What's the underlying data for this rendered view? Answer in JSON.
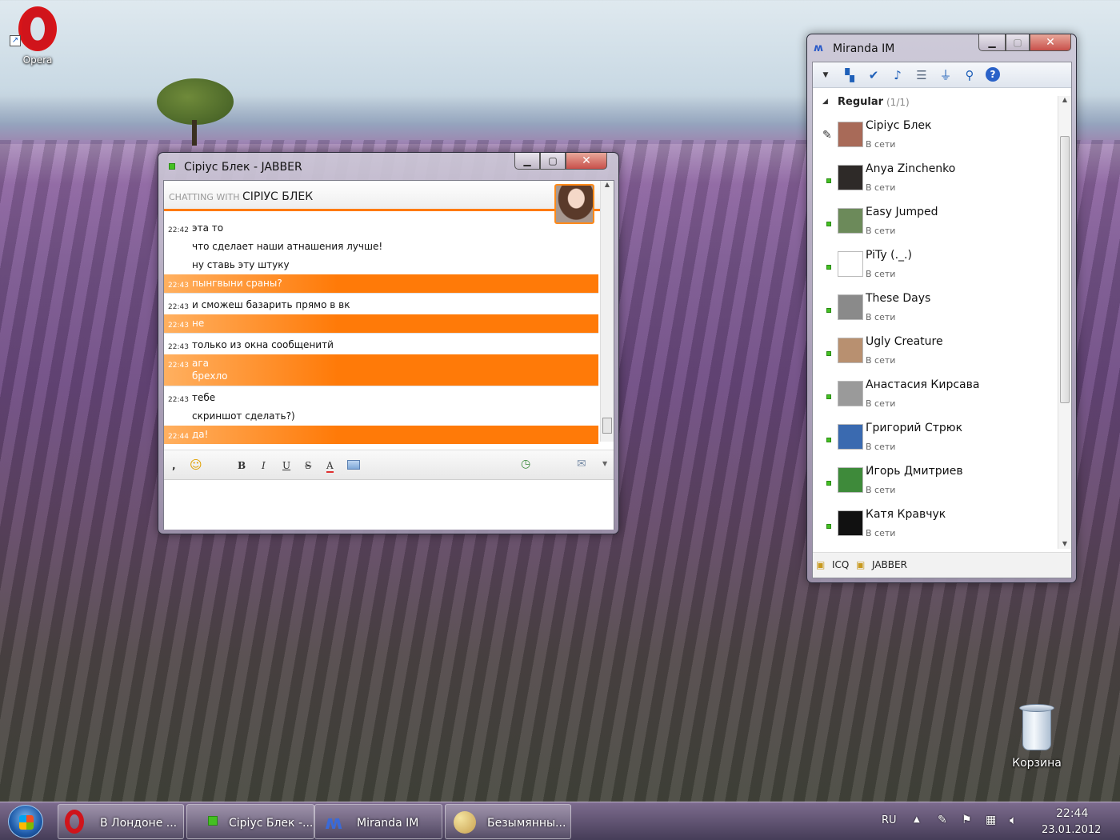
{
  "desktop": {
    "icons": [
      {
        "label": "Opera"
      },
      {
        "label": "Корзина"
      }
    ]
  },
  "chat_window": {
    "title": "Сіріус Блек - JABBER",
    "header_prefix": "CHATTING WITH",
    "header_name": "СІРІУС БЛЕК",
    "messages": [
      {
        "time": "22:42",
        "text": "эта то",
        "out": false
      },
      {
        "time": "",
        "text": "что сделает наши атнашения лучше!",
        "out": false
      },
      {
        "time": "",
        "text": "ну ставь эту штуку",
        "out": false
      },
      {
        "time": "22:43",
        "text": "пынгвыни сраны?",
        "out": true
      },
      {
        "time": "22:43",
        "text": "и сможеш базарить прямо в вк",
        "out": false
      },
      {
        "time": "22:43",
        "text": "не",
        "out": true
      },
      {
        "time": "22:43",
        "text": "только из окна сообщенитй",
        "out": false
      },
      {
        "time": "22:43",
        "text": "ага",
        "text2": "брехло",
        "out": true
      },
      {
        "time": "22:43",
        "text": "тебе",
        "out": false
      },
      {
        "time": "",
        "text": "скриншот сделать?)",
        "out": false
      },
      {
        "time": "22:44",
        "text": "да!",
        "out": true
      }
    ],
    "toolbar": {
      "bold": "B",
      "italic": "I",
      "underline": "U",
      "strike": "S",
      "color": "A"
    }
  },
  "miranda": {
    "title": "Miranda IM",
    "group": {
      "name": "Regular",
      "count": "(1/1)"
    },
    "contacts": [
      {
        "name": "Сіріус Блек",
        "status": "В сети",
        "typing": true,
        "avatar_color": "#a86a58"
      },
      {
        "name": "Anya Zinchenko",
        "status": "В сети",
        "typing": false,
        "avatar_color": "#2e2a28"
      },
      {
        "name": "Easy Jumped",
        "status": "В сети",
        "typing": false,
        "avatar_color": "#6c8a5a"
      },
      {
        "name": "PiTy (._.)",
        "status": "В сети",
        "typing": false,
        "avatar_color": "#ffffff"
      },
      {
        "name": "These Days",
        "status": "В сети",
        "typing": false,
        "avatar_color": "#8a8a8a"
      },
      {
        "name": "Ugly Creature",
        "status": "В сети",
        "typing": false,
        "avatar_color": "#b89070"
      },
      {
        "name": "Анастасия Кирсава",
        "status": "В сети",
        "typing": false,
        "avatar_color": "#9a9a9a"
      },
      {
        "name": "Григорий Стрюк",
        "status": "В сети",
        "typing": false,
        "avatar_color": "#3a6ab0"
      },
      {
        "name": "Игорь Дмитриев",
        "status": "В сети",
        "typing": false,
        "avatar_color": "#3e8a3a"
      },
      {
        "name": "Катя Кравчук",
        "status": "В сети",
        "typing": false,
        "avatar_color": "#111111"
      }
    ],
    "status_bar": {
      "proto1": "ICQ",
      "proto2": "JABBER"
    }
  },
  "taskbar": {
    "tasks": [
      {
        "label": "В Лондоне ..."
      },
      {
        "label": "Сіріус Блек -..."
      },
      {
        "label": "Miranda IM"
      },
      {
        "label": "Безымянны..."
      }
    ],
    "lang": "RU",
    "time": "22:44",
    "date": "23.01.2012"
  },
  "colors": {
    "accent_orange": "#ff7a08",
    "online_green": "#44c022"
  }
}
